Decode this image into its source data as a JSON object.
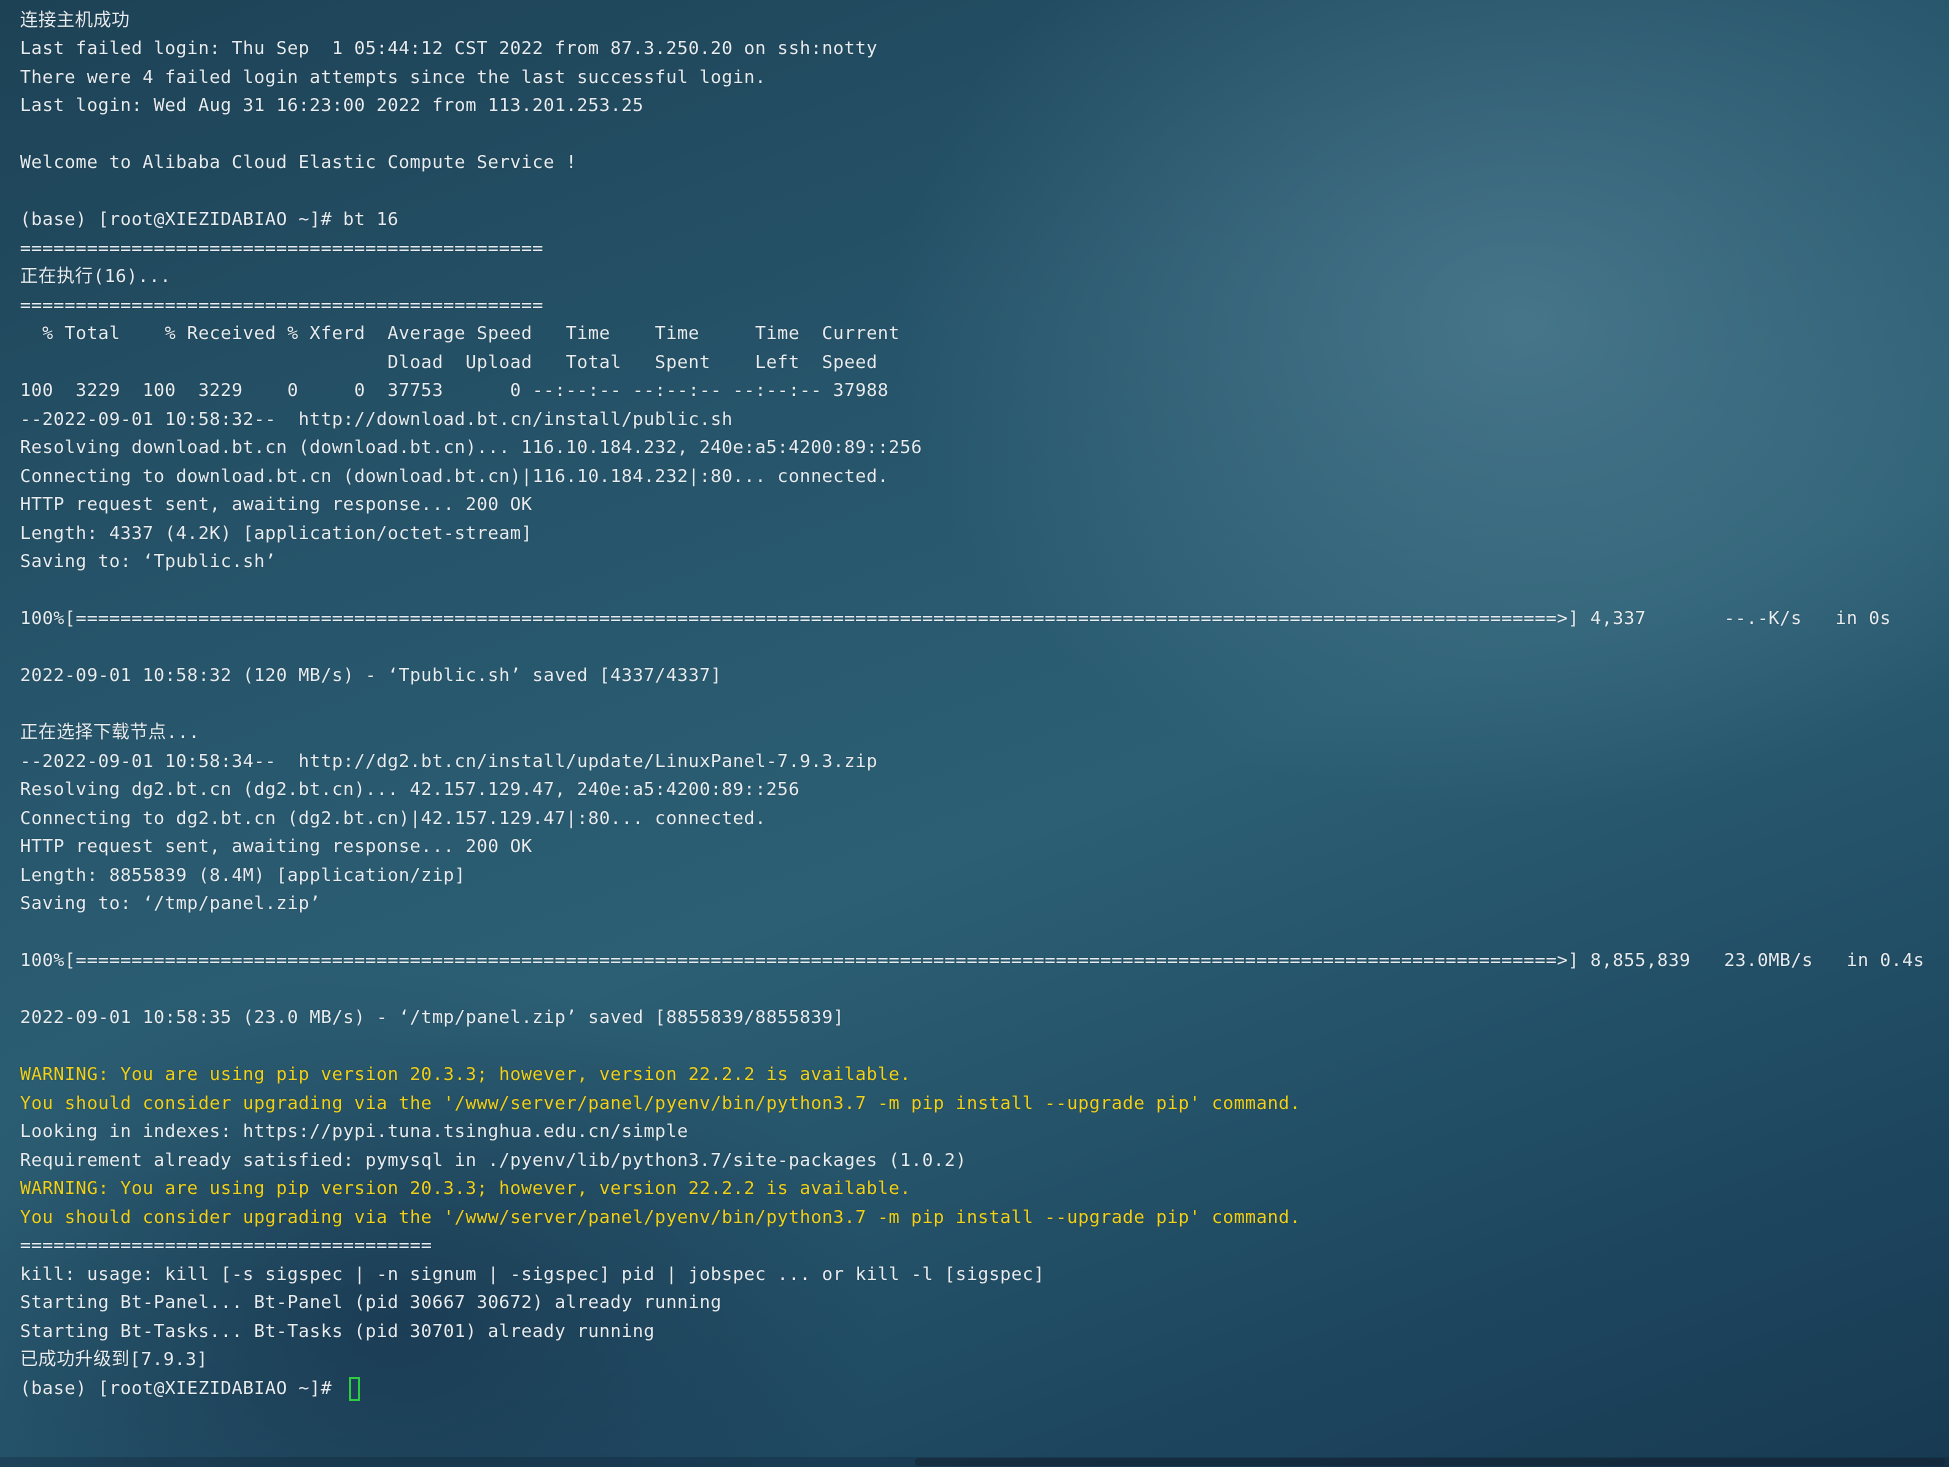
{
  "terminal": {
    "lines": [
      "连接主机...",
      "连接主机成功",
      "Last failed login: Thu Sep  1 05:44:12 CST 2022 from 87.3.250.20 on ssh:notty",
      "There were 4 failed login attempts since the last successful login.",
      "Last login: Wed Aug 31 16:23:00 2022 from 113.201.253.25",
      "",
      "Welcome to Alibaba Cloud Elastic Compute Service !",
      "",
      "(base) [root@XIEZIDABIAO ~]# bt 16",
      "===============================================",
      "正在执行(16)...",
      "===============================================",
      "  % Total    % Received % Xferd  Average Speed   Time    Time     Time  Current",
      "                                 Dload  Upload   Total   Spent    Left  Speed",
      "100  3229  100  3229    0     0  37753      0 --:--:-- --:--:-- --:--:-- 37988",
      "--2022-09-01 10:58:32--  http://download.bt.cn/install/public.sh",
      "Resolving download.bt.cn (download.bt.cn)... 116.10.184.232, 240e:a5:4200:89::256",
      "Connecting to download.bt.cn (download.bt.cn)|116.10.184.232|:80... connected.",
      "HTTP request sent, awaiting response... 200 OK",
      "Length: 4337 (4.2K) [application/octet-stream]",
      "Saving to: ‘Tpublic.sh’",
      "",
      "100%[=====================================================================================================================================>] 4,337       --.-K/s   in 0s",
      "",
      "2022-09-01 10:58:32 (120 MB/s) - ‘Tpublic.sh’ saved [4337/4337]",
      "",
      "正在选择下载节点...",
      "--2022-09-01 10:58:34--  http://dg2.bt.cn/install/update/LinuxPanel-7.9.3.zip",
      "Resolving dg2.bt.cn (dg2.bt.cn)... 42.157.129.47, 240e:a5:4200:89::256",
      "Connecting to dg2.bt.cn (dg2.bt.cn)|42.157.129.47|:80... connected.",
      "HTTP request sent, awaiting response... 200 OK",
      "Length: 8855839 (8.4M) [application/zip]",
      "Saving to: ‘/tmp/panel.zip’",
      "",
      "100%[=====================================================================================================================================>] 8,855,839   23.0MB/s   in 0.4s",
      "",
      "2022-09-01 10:58:35 (23.0 MB/s) - ‘/tmp/panel.zip’ saved [8855839/8855839]",
      "",
      "WARNING: You are using pip version 20.3.3; however, version 22.2.2 is available.",
      "You should consider upgrading via the '/www/server/panel/pyenv/bin/python3.7 -m pip install --upgrade pip' command.",
      "Looking in indexes: https://pypi.tuna.tsinghua.edu.cn/simple",
      "Requirement already satisfied: pymysql in ./pyenv/lib/python3.7/site-packages (1.0.2)",
      "WARNING: You are using pip version 20.3.3; however, version 22.2.2 is available.",
      "You should consider upgrading via the '/www/server/panel/pyenv/bin/python3.7 -m pip install --upgrade pip' command.",
      "=====================================",
      "kill: usage: kill [-s sigspec | -n signum | -sigspec] pid | jobspec ... or kill -l [sigspec]",
      "Starting Bt-Panel... Bt-Panel (pid 30667 30672) already running",
      "Starting Bt-Tasks... Bt-Tasks (pid 30701) already running",
      "已成功升级到[7.9.3]"
    ],
    "warning_line_indexes": [
      38,
      39,
      42,
      43
    ],
    "prompt": "(base) [root@XIEZIDABIAO ~]# ",
    "colors": {
      "text": "#e8eef2",
      "warning": "#f2d21b",
      "cursor": "#2ecc40"
    }
  }
}
